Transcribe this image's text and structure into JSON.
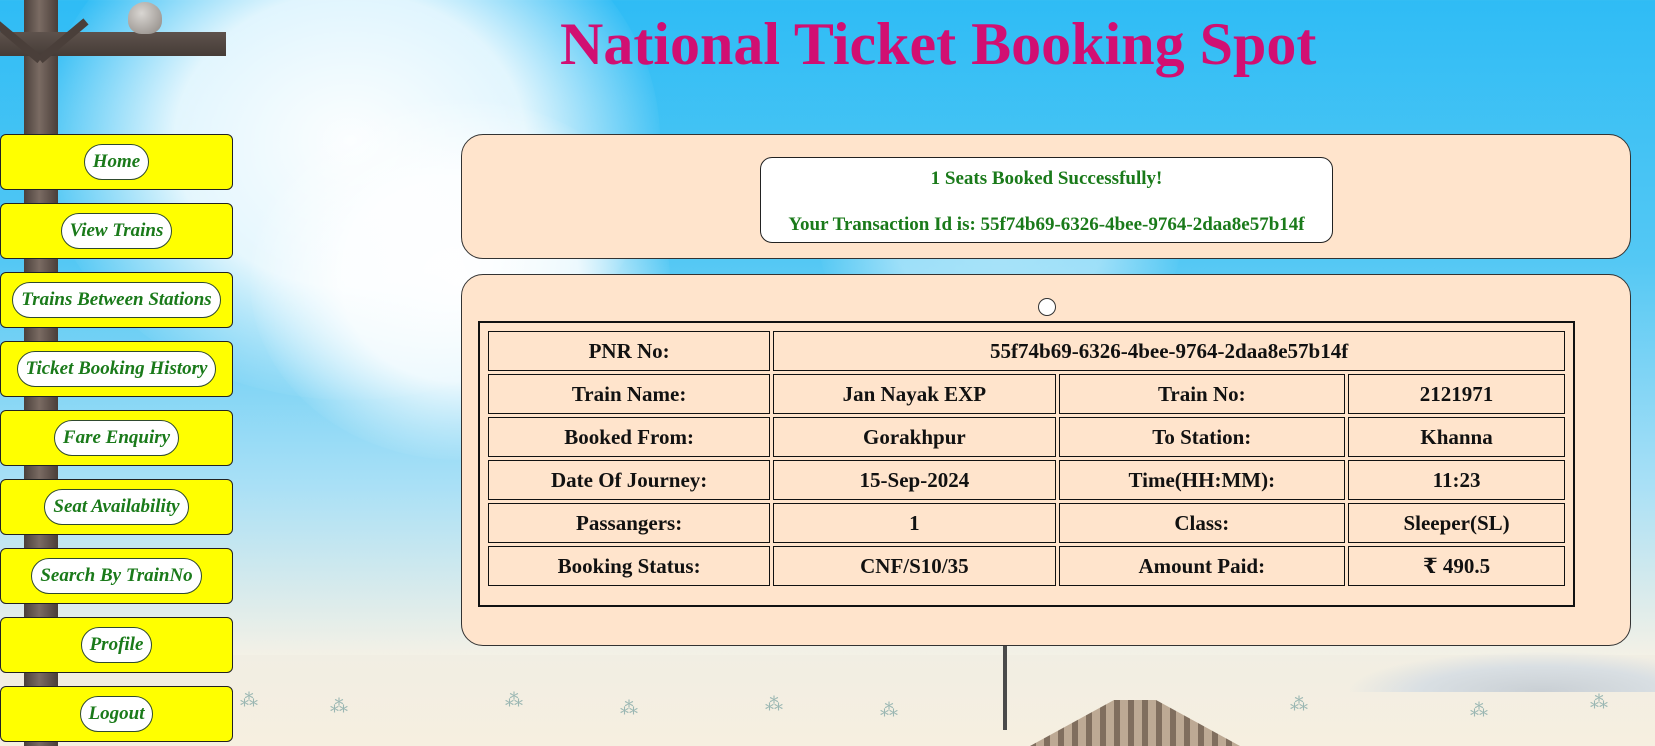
{
  "page": {
    "title": "National Ticket Booking Spot",
    "title_color": "#d10f72"
  },
  "sidebar": {
    "items": [
      {
        "label": "Home"
      },
      {
        "label": "View Trains"
      },
      {
        "label": "Trains Between Stations"
      },
      {
        "label": "Ticket Booking History"
      },
      {
        "label": "Fare Enquiry"
      },
      {
        "label": "Seat Availability"
      },
      {
        "label": "Search By TrainNo"
      },
      {
        "label": "Profile"
      },
      {
        "label": "Logout"
      }
    ],
    "button_color": "#ffff00",
    "text_color": "#1a7a1a"
  },
  "message": {
    "success": "1 Seats Booked Successfully!",
    "transaction": "Your Transaction Id is: 55f74b69-6326-4bee-9764-2daa8e57b14f"
  },
  "ticket": {
    "pnr_label": "PNR No:",
    "pnr_value": "55f74b69-6326-4bee-9764-2daa8e57b14f",
    "train_name_label": "Train Name:",
    "train_name_value": "Jan Nayak EXP",
    "train_no_label": "Train No:",
    "train_no_value": "2121971",
    "from_label": "Booked From:",
    "from_value": "Gorakhpur",
    "to_label": "To Station:",
    "to_value": "Khanna",
    "date_label": "Date Of Journey:",
    "date_value": "15-Sep-2024",
    "time_label": "Time(HH:MM):",
    "time_value": "11:23",
    "passengers_label": "Passangers:",
    "passengers_value": "1",
    "class_label": "Class:",
    "class_value": "Sleeper(SL)",
    "status_label": "Booking Status:",
    "status_value": "CNF/S10/35",
    "amount_label": "Amount Paid:",
    "amount_value": "₹ 490.5"
  },
  "colors": {
    "panel_bg": "#ffe4cc",
    "pnr_color": "#1b1bea",
    "status_color": "#1a7a1a"
  }
}
